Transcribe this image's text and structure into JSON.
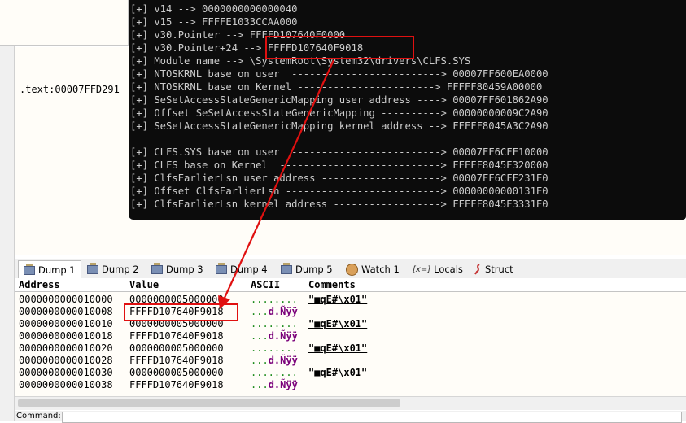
{
  "disasm": {
    "line": ".text:00007FFD291"
  },
  "console": {
    "lines": [
      "[+] v14 --> 0000000000000040",
      "[+] v15 --> FFFFE1033CCAA000",
      "[+] v30.Pointer --> FFFFD107640F0000",
      "[+] v30.Pointer+24 --> FFFFD107640F9018",
      "[+] Module name --> \\SystemRoot\\System32\\drivers\\CLFS.SYS",
      "[+] NTOSKRNL base on user  -------------------------> 00007FF600EA0000",
      "[+] NTOSKRNL base on Kernel -----------------------> FFFFF80459A00000",
      "[+] SeSetAccessStateGenericMapping user address ----> 00007FF601862A90",
      "[+] Offset SeSetAccessStateGenericMapping ----------> 00000000009C2A90",
      "[+] SeSetAccessStateGenericMapping kernel address --> FFFFF8045A3C2A90",
      "",
      "[+] CLFS.SYS base on user  -------------------------> 00007FF6CFF10000",
      "[+] CLFS base on Kernel  ---------------------------> FFFFF8045E320000",
      "[+] ClfsEarlierLsn user address --------------------> 00007FF6CFF231E0",
      "[+] Offset ClfsEarlierLsn --------------------------> 00000000000131E0",
      "[+] ClfsEarlierLsn kernel address ------------------> FFFFF8045E3331E0"
    ]
  },
  "tabs": [
    {
      "label": "Dump 1",
      "icon": "dump-icon"
    },
    {
      "label": "Dump 2",
      "icon": "dump-icon"
    },
    {
      "label": "Dump 3",
      "icon": "dump-icon"
    },
    {
      "label": "Dump 4",
      "icon": "dump-icon"
    },
    {
      "label": "Dump 5",
      "icon": "dump-icon"
    },
    {
      "label": "Watch 1",
      "icon": "watch-icon"
    },
    {
      "label": "Locals",
      "icon": "locals-icon",
      "glyph": "[x=]"
    },
    {
      "label": "Struct",
      "icon": "struct-icon"
    }
  ],
  "dump": {
    "headers": {
      "address": "Address",
      "value": "Value",
      "ascii": "ASCII",
      "comments": "Comments"
    },
    "rows": [
      {
        "address": "0000000000010000",
        "value": "0000000005000000",
        "ascii_dots": "........",
        "ascii_tail": "",
        "comment": "\"■qE#\\x01\""
      },
      {
        "address": "0000000000010008",
        "value": "FFFFD107640F9018",
        "ascii_dots": "...",
        "ascii_tail": "d.Ñÿÿ",
        "comment": ""
      },
      {
        "address": "0000000000010010",
        "value": "0000000005000000",
        "ascii_dots": "........",
        "ascii_tail": "",
        "comment": "\"■qE#\\x01\""
      },
      {
        "address": "0000000000010018",
        "value": "FFFFD107640F9018",
        "ascii_dots": "...",
        "ascii_tail": "d.Ñÿÿ",
        "comment": ""
      },
      {
        "address": "0000000000010020",
        "value": "0000000005000000",
        "ascii_dots": "........",
        "ascii_tail": "",
        "comment": "\"■qE#\\x01\""
      },
      {
        "address": "0000000000010028",
        "value": "FFFFD107640F9018",
        "ascii_dots": "...",
        "ascii_tail": "d.Ñÿÿ",
        "comment": ""
      },
      {
        "address": "0000000000010030",
        "value": "0000000005000000",
        "ascii_dots": "........",
        "ascii_tail": "",
        "comment": "\"■qE#\\x01\""
      },
      {
        "address": "0000000000010038",
        "value": "FFFFD107640F9018",
        "ascii_dots": "...",
        "ascii_tail": "d.Ñÿÿ",
        "comment": ""
      }
    ]
  },
  "command_bar": {
    "label": "Command:"
  },
  "colors": {
    "highlight": "#e01010",
    "console_bg": "#0c0c0c",
    "console_fg": "#cccccc"
  }
}
